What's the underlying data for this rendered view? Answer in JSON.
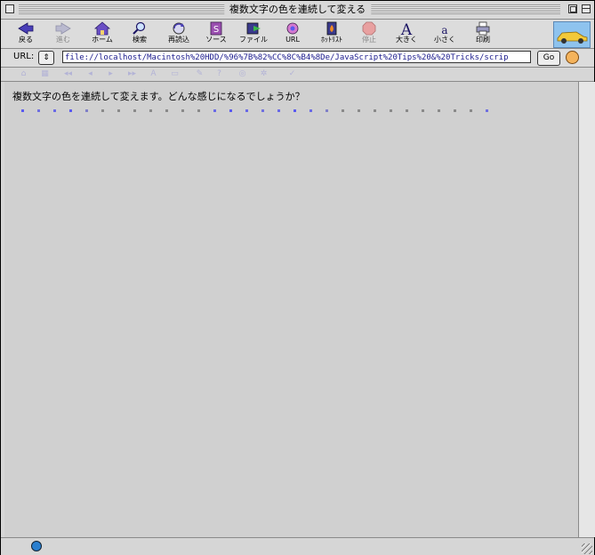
{
  "window": {
    "title": "複数文字の色を連続して変える"
  },
  "toolbar": {
    "buttons": [
      {
        "label": "戻る",
        "enabled": true,
        "icon": "back-arrow-icon"
      },
      {
        "label": "進む",
        "enabled": false,
        "icon": "forward-arrow-icon"
      },
      {
        "label": "ホーム",
        "enabled": true,
        "icon": "home-icon"
      },
      {
        "label": "検索",
        "enabled": true,
        "icon": "search-icon"
      },
      {
        "label": "再読込",
        "enabled": true,
        "icon": "reload-icon"
      },
      {
        "label": "ソース",
        "enabled": true,
        "icon": "source-icon"
      },
      {
        "label": "ファイル",
        "enabled": true,
        "icon": "file-icon"
      },
      {
        "label": "URL",
        "enabled": true,
        "icon": "url-icon"
      },
      {
        "label": "ﾎｯﾄﾘｽﾄ",
        "enabled": true,
        "icon": "hotlist-icon"
      },
      {
        "label": "停止",
        "enabled": false,
        "icon": "stop-icon"
      },
      {
        "label": "大きく",
        "enabled": true,
        "icon": "larger-text-icon"
      },
      {
        "label": "小さく",
        "enabled": true,
        "icon": "smaller-text-icon"
      },
      {
        "label": "印刷",
        "enabled": true,
        "icon": "print-icon"
      }
    ]
  },
  "urlbar": {
    "label": "URL:",
    "value": "file://localhost/Macintosh%20HDD/%96%7B%82%CC%8C%B4%8De/JavaScript%20Tips%20&%20Tricks/scrip",
    "go_label": "Go"
  },
  "content": {
    "message": "複数文字の色を連続して変えます。どんな感じになるでしょうか？",
    "dot_colors": [
      "#5a5af0",
      "#7070e0",
      "#6a6ae6",
      "#5a5af0",
      "#8080c8",
      "#8a8a8a",
      "#8a8a8a",
      "#8a8a8a",
      "#8a8a8a",
      "#8a8a8a",
      "#8a8a8a",
      "#8a8a8a",
      "#6a6ae6",
      "#5a5af0",
      "#6a6ae6",
      "#7070e0",
      "#6a6ae6",
      "#5a5af0",
      "#6a6ae6",
      "#8080c8",
      "#8a8a8a",
      "#8a8a8a",
      "#8a8a8a",
      "#8a8a8a",
      "#8a8a8a",
      "#8a8a8a",
      "#8a8a8a",
      "#8a8a8a",
      "#8a8a8a",
      "#7070e0"
    ]
  },
  "colors": {
    "accent": "#5a5af0",
    "chrome": "#d6d6d6"
  }
}
